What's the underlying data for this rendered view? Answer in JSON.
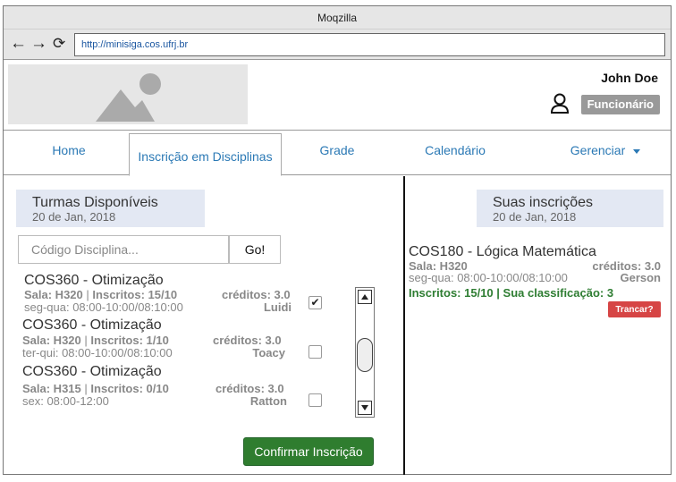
{
  "browser": {
    "window_title": "Moqzilla",
    "url": "http://minisiga.cos.ufrj.br"
  },
  "header": {
    "user_name": "John Doe",
    "role": "Funcionário"
  },
  "tabs": [
    {
      "label": "Home"
    },
    {
      "label": "Inscrição em Disciplinas",
      "active": true
    },
    {
      "label": "Grade"
    },
    {
      "label": "Calendário"
    },
    {
      "label": "Gerenciar"
    }
  ],
  "available": {
    "title": "Turmas Disponíveis",
    "date": "20 de Jan, 2018",
    "search_placeholder": "Código Disciplina...",
    "go_label": "Go!",
    "courses": [
      {
        "title": "COS360 - Otimização",
        "sala": "Sala: H320",
        "inscritos": "Inscritos: 15/10",
        "creditos": "créditos: 3.0",
        "schedule": "seg-qua: 08:00-10:00/08:10:00",
        "professor": "Luidi",
        "checked": true
      },
      {
        "title": "COS360 - Otimização",
        "sala": "Sala: H320",
        "inscritos": "Inscritos: 1/10",
        "creditos": "créditos: 3.0",
        "schedule": "ter-qui: 08:00-10:00/08:10:00",
        "professor": "Toacy",
        "checked": false
      },
      {
        "title": "COS360 - Otimização",
        "sala": "Sala: H315",
        "inscritos": "Inscritos: 0/10",
        "creditos": "créditos: 3.0",
        "schedule": "sex: 08:00-12:00",
        "professor": "Ratton",
        "checked": false
      }
    ],
    "confirm_label": "Confirmar Inscrição"
  },
  "enrolled": {
    "title": "Suas inscrições",
    "date": "20 de Jan, 2018",
    "items": [
      {
        "title": "COS180 - Lógica Matemática",
        "sala": "Sala: H320",
        "creditos": "créditos: 3.0",
        "schedule": "seg-qua: 08:00-10:00/08:10:00",
        "professor": "Gerson",
        "status": "Inscritos: 15/10 | Sua classificação: 3",
        "action_label": "Trancar?"
      }
    ]
  },
  "colors": {
    "accent_link": "#2b79b5",
    "confirm_green": "#2f7d2f",
    "status_green": "#2e7d32",
    "danger_red": "#d64545",
    "section_bg": "#e3e8f3"
  }
}
